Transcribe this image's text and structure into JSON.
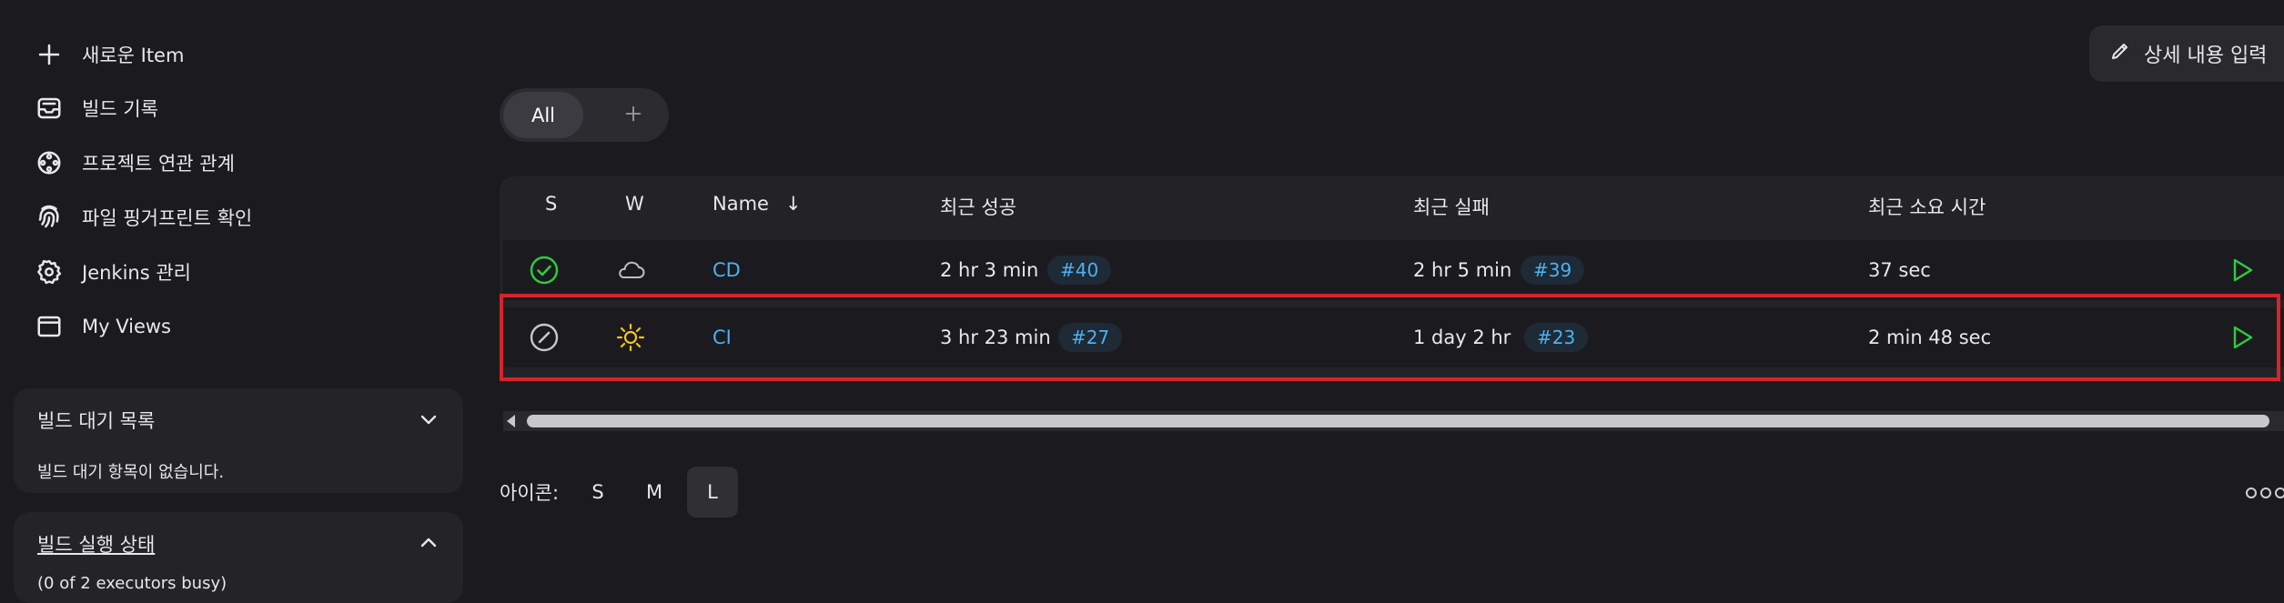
{
  "sidebar": {
    "items": [
      {
        "label": "새로운 Item",
        "icon": "plus-icon"
      },
      {
        "label": "빌드 기록",
        "icon": "inbox-icon"
      },
      {
        "label": "프로젝트 연관 관계",
        "icon": "relationship-icon"
      },
      {
        "label": "파일 핑거프린트 확인",
        "icon": "fingerprint-icon"
      },
      {
        "label": "Jenkins 관리",
        "icon": "gear-icon"
      },
      {
        "label": "My Views",
        "icon": "window-icon"
      }
    ],
    "build_queue": {
      "title": "빌드 대기 목록",
      "empty_text": "빌드 대기 항목이 없습니다."
    },
    "executor_status": {
      "title": "빌드 실행 상태",
      "subtitle": "(0 of 2 executors busy)"
    }
  },
  "header": {
    "edit_description_label": "상세 내용 입력"
  },
  "view_tabs": {
    "all_label": "All"
  },
  "table": {
    "headers": {
      "s": "S",
      "w": "W",
      "name": "Name",
      "sort_arrow": "↓",
      "last_success": "최근 성공",
      "last_failure": "최근 실패",
      "last_duration": "최근 소요 시간"
    },
    "rows": [
      {
        "status": "success",
        "weather": "cloudy",
        "name": "CD",
        "last_success": "2 hr 3 min",
        "success_build": "#40",
        "last_failure": "2 hr 5 min",
        "failure_build": "#39",
        "duration": "37 sec"
      },
      {
        "status": "not-built",
        "weather": "sunny",
        "name": "CI",
        "last_success": "3 hr 23 min",
        "success_build": "#27",
        "last_failure": "1 day 2 hr",
        "failure_build": "#23",
        "duration": "2 min 48 sec"
      }
    ]
  },
  "icon_size": {
    "label": "아이콘:",
    "options": [
      "S",
      "M",
      "L"
    ],
    "selected": "L"
  },
  "colors": {
    "accent_link": "#4db0f0",
    "success_green": "#2ecc40",
    "highlight_red": "#d8232a",
    "sun_yellow": "#f5c518"
  }
}
